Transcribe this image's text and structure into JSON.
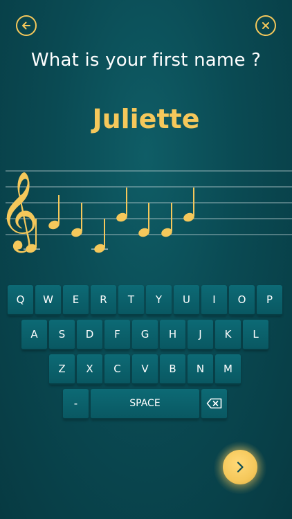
{
  "header": {
    "back_icon": "arrow-left-icon",
    "close_icon": "close-icon",
    "question": "What is your first name ?"
  },
  "name": {
    "value": "Juliette"
  },
  "staff": {
    "clef_icon": "treble-clef-icon",
    "note_count": 8
  },
  "keyboard": {
    "row1": [
      "Q",
      "W",
      "E",
      "R",
      "T",
      "Y",
      "U",
      "I",
      "O",
      "P"
    ],
    "row2": [
      "A",
      "S",
      "D",
      "F",
      "G",
      "H",
      "J",
      "K",
      "L"
    ],
    "row3": [
      "Z",
      "X",
      "C",
      "V",
      "B",
      "N",
      "M"
    ],
    "hyphen_label": "-",
    "space_label": "SPACE",
    "backspace_icon": "backspace-icon"
  },
  "next_button": {
    "icon": "chevron-right-icon"
  },
  "colors": {
    "accent": "#f5c85b",
    "background": "#0a4a53",
    "key": "#0d6a75"
  }
}
